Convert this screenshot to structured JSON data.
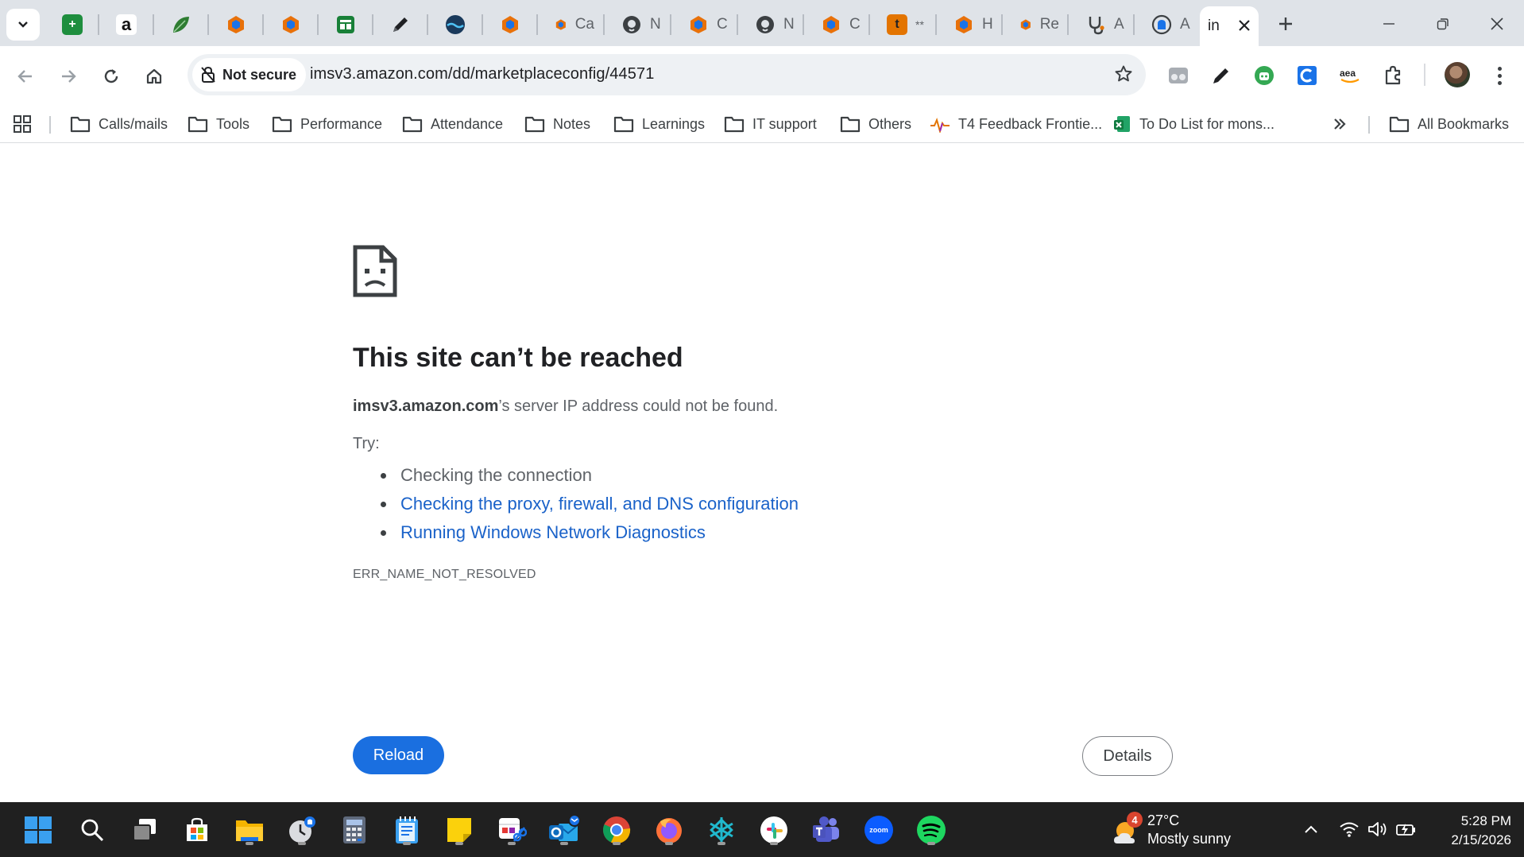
{
  "browser": {
    "tabs": [
      {
        "icon": "google-sheets-icon",
        "color": "#1e8e3e",
        "label": ""
      },
      {
        "icon": "amazon-icon",
        "color": "#ffffff",
        "label": ""
      },
      {
        "icon": "leaf-icon",
        "color": "#2e7d32",
        "label": ""
      },
      {
        "icon": "quicksight-icon",
        "color": "#e8710a",
        "label": ""
      },
      {
        "icon": "quicksight-icon",
        "color": "#e8710a",
        "label": ""
      },
      {
        "icon": "table-icon",
        "color": "#188038",
        "label": ""
      },
      {
        "icon": "pencil-icon",
        "color": "#202124",
        "label": ""
      },
      {
        "icon": "river-icon",
        "color": "#1a3a5c",
        "label": ""
      },
      {
        "icon": "quicksight-icon",
        "color": "#e8710a",
        "label": ""
      },
      {
        "icon": "quicksight-icon",
        "color": "#e8710a",
        "label": "Ca"
      },
      {
        "icon": "github-icon",
        "color": "#3c4043",
        "label": "N"
      },
      {
        "icon": "quicksight-icon",
        "color": "#e8710a",
        "label": "C"
      },
      {
        "icon": "github-icon",
        "color": "#3c4043",
        "label": "N"
      },
      {
        "icon": "quicksight-icon",
        "color": "#e8710a",
        "label": "C"
      },
      {
        "icon": "t-logo-icon",
        "color": "#e37400",
        "label": "**"
      },
      {
        "icon": "quicksight-icon",
        "color": "#e8710a",
        "label": "H"
      },
      {
        "icon": "quicksight-icon",
        "color": "#e8710a",
        "label": "Re"
      },
      {
        "icon": "stethoscope-icon",
        "color": "#3c4043",
        "label": "A"
      },
      {
        "icon": "bell-logo-icon",
        "color": "#3c4043",
        "label": "A"
      },
      {
        "icon": "",
        "color": "",
        "label": "in"
      }
    ],
    "address": {
      "security_label": "Not secure",
      "url": "imsv3.amazon.com/dd/marketplaceconfig/44571"
    },
    "bookmarks": [
      {
        "label": "Calls/mails",
        "icon": "folder-icon"
      },
      {
        "label": "Tools",
        "icon": "folder-icon"
      },
      {
        "label": "Performance",
        "icon": "folder-icon"
      },
      {
        "label": "Attendance",
        "icon": "folder-icon"
      },
      {
        "label": "Notes",
        "icon": "folder-icon"
      },
      {
        "label": "Learnings",
        "icon": "folder-icon"
      },
      {
        "label": "IT support",
        "icon": "folder-icon"
      },
      {
        "label": "Others",
        "icon": "folder-icon"
      },
      {
        "label": "T4 Feedback Frontie...",
        "icon": "pulse-icon"
      },
      {
        "label": "To Do List for mons...",
        "icon": "excel-icon"
      }
    ],
    "all_bookmarks_label": "All Bookmarks"
  },
  "error_page": {
    "title": "This site can’t be reached",
    "host": "imsv3.amazon.com",
    "message_suffix": "’s server IP address could not be found.",
    "try_label": "Try:",
    "suggestions": [
      {
        "text": "Checking the connection",
        "is_link": false
      },
      {
        "text": "Checking the proxy, firewall, and DNS configuration",
        "is_link": true
      },
      {
        "text": "Running Windows Network Diagnostics",
        "is_link": true
      }
    ],
    "error_code": "ERR_NAME_NOT_RESOLVED",
    "reload_label": "Reload",
    "details_label": "Details"
  },
  "taskbar": {
    "apps": [
      "start-icon",
      "search-icon",
      "task-view-icon",
      "microsoft-store-icon",
      "file-explorer-icon",
      "clock-app-icon",
      "calculator-icon",
      "notepad-icon",
      "sticky-notes-icon",
      "snipping-tool-icon",
      "outlook-icon",
      "chrome-icon",
      "firefox-icon",
      "perplexity-icon",
      "slack-icon",
      "teams-icon",
      "zoom-icon",
      "spotify-icon"
    ],
    "weather": {
      "badge": "4",
      "temperature": "27°C",
      "condition": "Mostly sunny"
    },
    "clock": {
      "time": "5:28 PM",
      "date": "2/15/2026"
    }
  },
  "colors": {
    "link": "#1a62c9",
    "reload_button": "#1a6fe0",
    "tabstrip": "#dfe3e8",
    "taskbar": "#202020"
  }
}
